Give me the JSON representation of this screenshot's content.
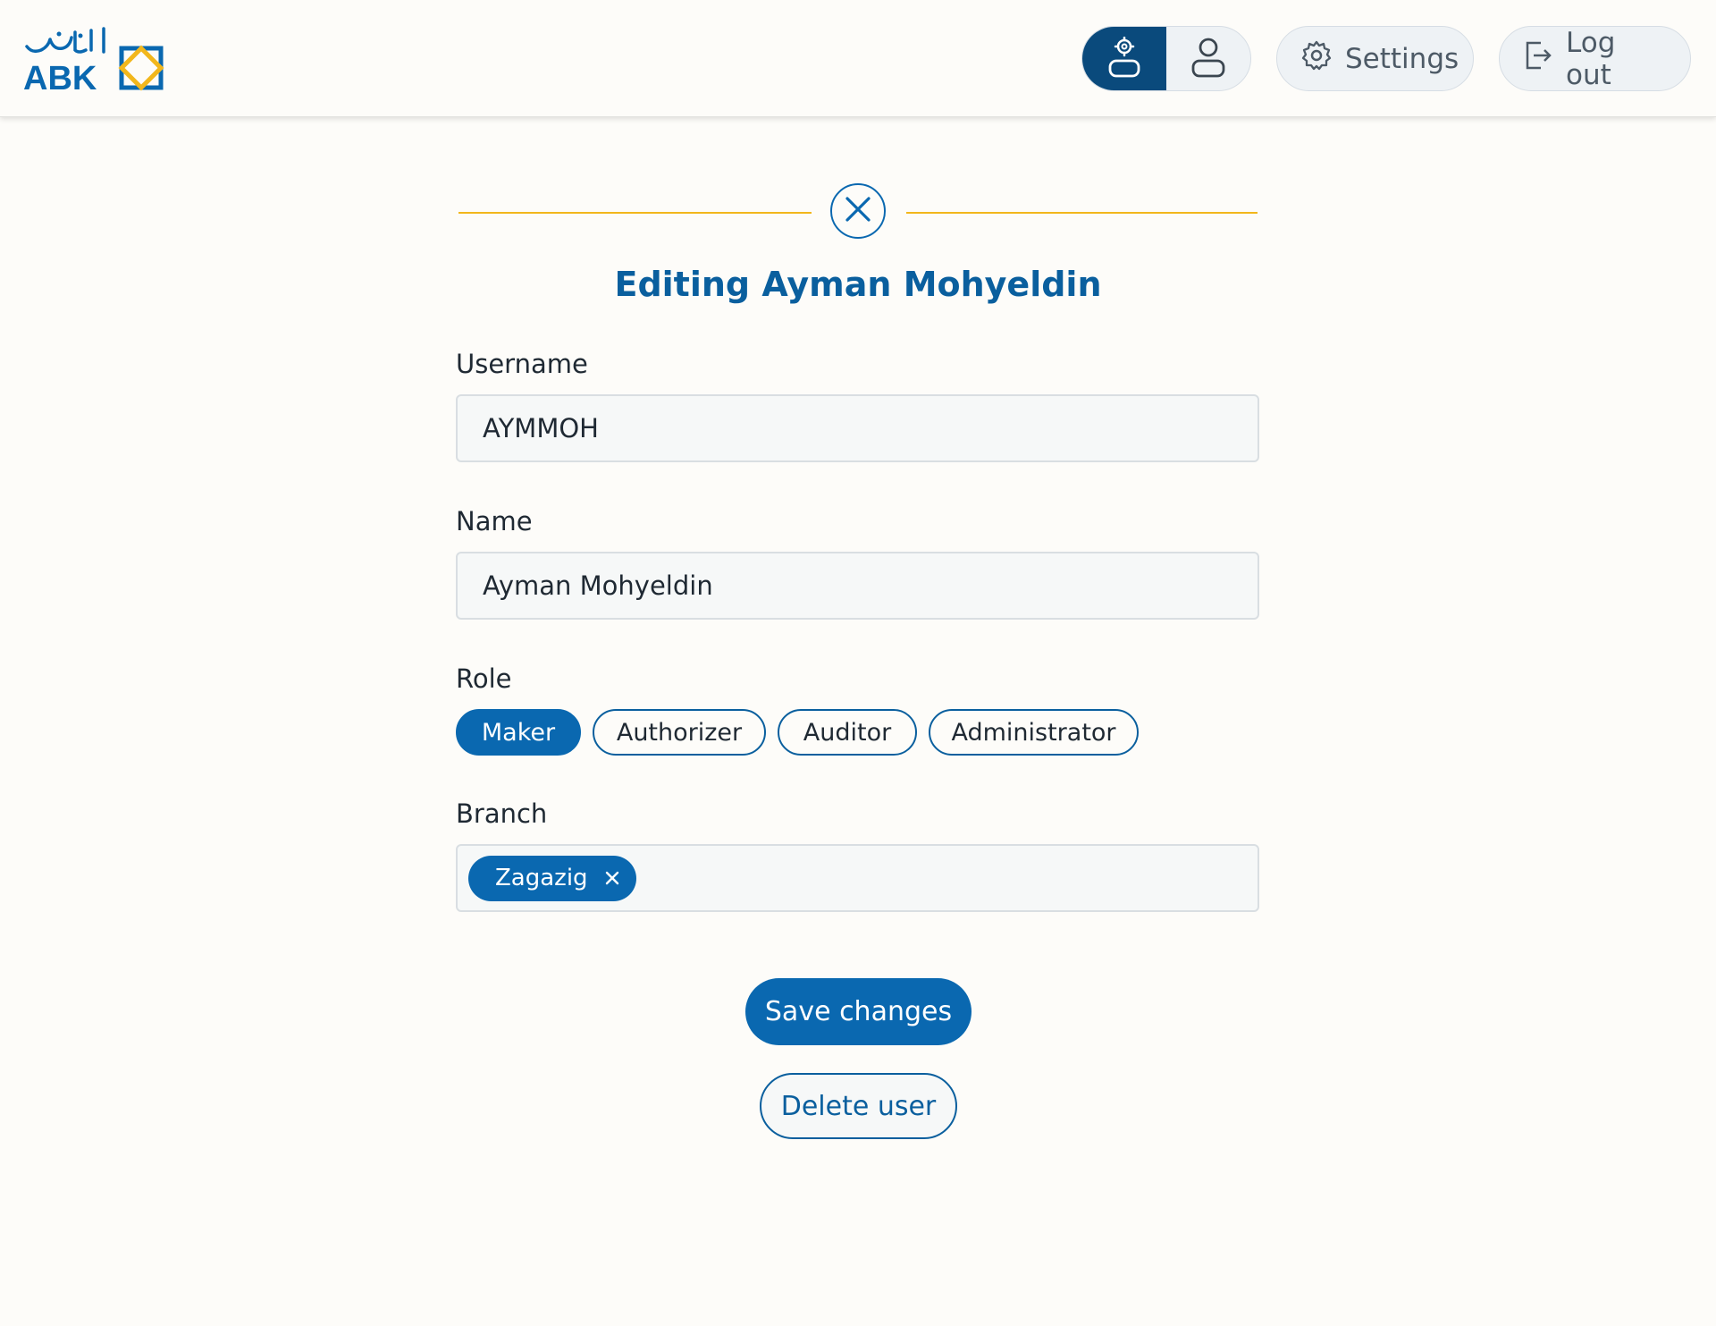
{
  "brand": {
    "logo_latin": "ABK",
    "logo_arabic": "الأهلي",
    "primary_color": "#0a68b0",
    "dark_color": "#0a4a7c",
    "accent_color": "#f2b71c"
  },
  "header": {
    "role_switch": [
      {
        "icon": "admin-user-gear-icon",
        "active": true
      },
      {
        "icon": "user-icon",
        "active": false
      }
    ],
    "settings_label": "Settings",
    "settings_icon": "gear-icon",
    "logout_label": "Log out",
    "logout_icon": "logout-icon"
  },
  "form": {
    "close_icon": "close-icon",
    "title": "Editing Ayman Mohyeldin",
    "username_label": "Username",
    "username_value": "AYMMOH",
    "name_label": "Name",
    "name_value": "Ayman Mohyeldin",
    "role_label": "Role",
    "roles": [
      {
        "label": "Maker",
        "selected": true
      },
      {
        "label": "Authorizer",
        "selected": false
      },
      {
        "label": "Auditor",
        "selected": false
      },
      {
        "label": "Administrator",
        "selected": false
      }
    ],
    "branch_label": "Branch",
    "branches": [
      {
        "label": "Zagazig",
        "remove_icon": "x-icon"
      }
    ],
    "save_label": "Save changes",
    "delete_label": "Delete user"
  }
}
